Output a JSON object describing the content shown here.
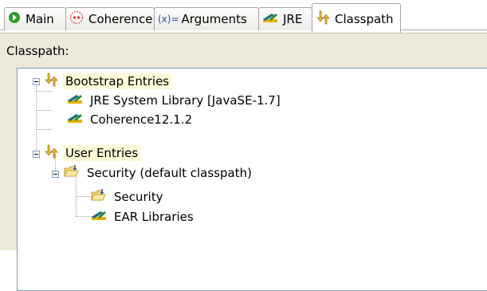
{
  "tabs": [
    {
      "label": "Main",
      "icon": "main-run-icon"
    },
    {
      "label": "Coherence",
      "icon": "coherence-icon"
    },
    {
      "label": "Arguments",
      "icon": "arguments-icon",
      "prefix": "(x)="
    },
    {
      "label": "JRE",
      "icon": "jre-library-icon"
    },
    {
      "label": "Classpath",
      "icon": "classpath-entries-icon",
      "active": true
    }
  ],
  "panel": {
    "label": "Classpath:"
  },
  "tree": {
    "bootstrap": {
      "label": "Bootstrap Entries",
      "icon": "classpath-entries-icon"
    },
    "jre": {
      "label": "JRE System Library [JavaSE-1.7]",
      "icon": "library-icon"
    },
    "coherence": {
      "label": "Coherence12.1.2",
      "icon": "library-icon"
    },
    "user": {
      "label": "User Entries",
      "icon": "classpath-entries-icon"
    },
    "security_default": {
      "label": "Security (default classpath)",
      "icon": "project-folder-icon"
    },
    "security": {
      "label": "Security",
      "icon": "project-folder-icon"
    },
    "ear": {
      "label": "EAR Libraries",
      "icon": "library-icon"
    }
  },
  "colors": {
    "accent_green": "#2e9b2e",
    "library_teal": "#1b6f83",
    "library_gold": "#e8b000",
    "highlight": "#fdf8d6",
    "panel_bg": "#ece9d8"
  }
}
